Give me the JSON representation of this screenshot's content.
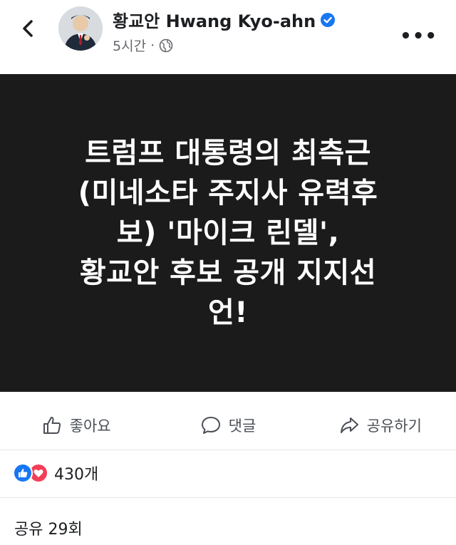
{
  "header": {
    "author_name": "황교안 Hwang Kyo-ahn",
    "time": "5시간",
    "separator": "·",
    "icons": {
      "back": "chevron-left-icon",
      "verified": "verified-badge-icon",
      "privacy": "globe-icon",
      "more": "more-horizontal-icon"
    },
    "more_label": "•••"
  },
  "post": {
    "lines": [
      "트럼프 대통령의 최측근",
      "(미네소타 주지사 유력후",
      "보) '마이크 린델',",
      "황교안 후보 공개 지지선",
      "언!"
    ],
    "background_color": "#1b1b1b",
    "text_color": "#ffffff"
  },
  "actions": {
    "like": "좋아요",
    "comment": "댓글",
    "share": "공유하기"
  },
  "stats": {
    "reaction_count": "430개",
    "shares": "공유 29회"
  },
  "colors": {
    "like_blue": "#1877f2",
    "love_red": "#f33e58",
    "verified_blue": "#1877f2"
  }
}
